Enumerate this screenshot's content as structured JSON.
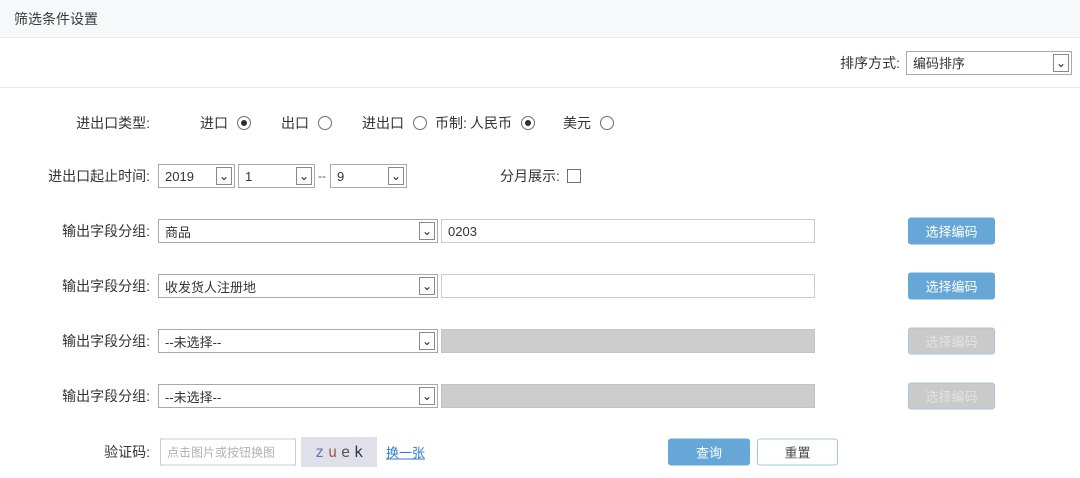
{
  "page": {
    "title": "筛选条件设置"
  },
  "sort": {
    "label": "排序方式:",
    "value": "编码排序"
  },
  "trade_type": {
    "label": "进出口类型:",
    "options": [
      {
        "label": "进口",
        "selected": true
      },
      {
        "label": "出口",
        "selected": false
      },
      {
        "label": "进出口",
        "selected": false
      }
    ]
  },
  "currency": {
    "label": "币制:",
    "options": [
      {
        "label": "人民币",
        "selected": true
      },
      {
        "label": "美元",
        "selected": false
      }
    ]
  },
  "time_range": {
    "label": "进出口起止时间:",
    "year": "2019",
    "start_month": "1",
    "separator": "--",
    "end_month": "9"
  },
  "monthly": {
    "label": "分月展示:",
    "checked": false
  },
  "field_groups": {
    "label": "输出字段分组:",
    "rows": [
      {
        "select": "商品",
        "input": "0203",
        "disabled": false,
        "button": "选择编码"
      },
      {
        "select": "收发货人注册地",
        "input": "",
        "disabled": false,
        "button": "选择编码"
      },
      {
        "select": "--未选择--",
        "input": "",
        "disabled": true,
        "button": "选择编码"
      },
      {
        "select": "--未选择--",
        "input": "",
        "disabled": true,
        "button": "选择编码"
      }
    ]
  },
  "captcha": {
    "label": "验证码:",
    "placeholder": "点击图片或按钮换图",
    "code": "zuek",
    "letters": [
      "z",
      "u",
      "e",
      "k"
    ],
    "letter_colors": [
      "#6b6bb4",
      "#a2574a",
      "#555555",
      "#333333"
    ],
    "refresh_link": "换一张"
  },
  "actions": {
    "query": "查询",
    "reset": "重置"
  },
  "icons": {
    "chevron_down": "⌄"
  },
  "colors": {
    "accent_blue": "#66a7d8",
    "button_border_blue": "#a5c6e0",
    "disabled_gray": "#cdcdcd",
    "header_bg": "#f6f8fa",
    "link_blue": "#2f7bd3",
    "captcha_bg": "#e0e0ea"
  }
}
